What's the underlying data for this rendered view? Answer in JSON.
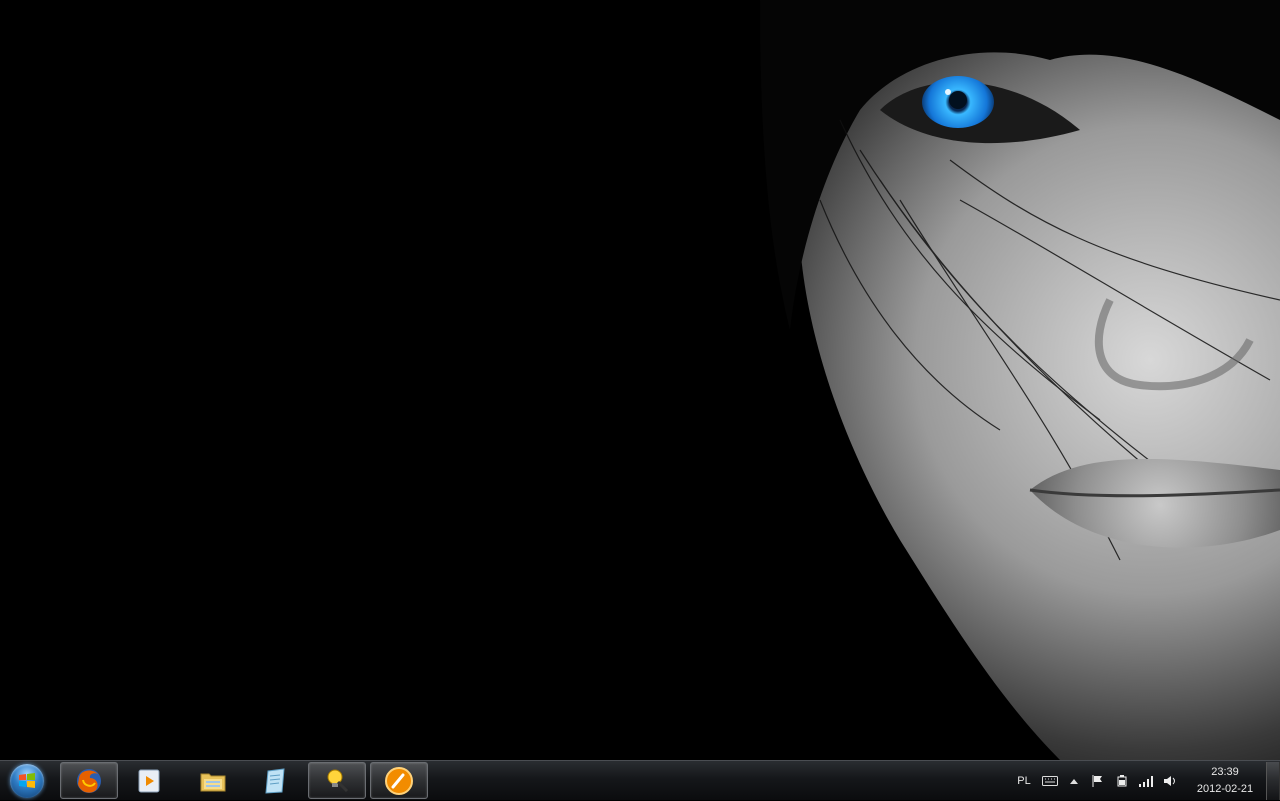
{
  "desktop": {
    "wallpaper": "dark-portrait-blue-eye"
  },
  "taskbar": {
    "start": {
      "icon": "windows-start-orb-icon"
    },
    "pinned": [
      {
        "name": "firefox",
        "icon": "firefox-icon",
        "running": true
      },
      {
        "name": "media-player",
        "icon": "media-player-icon",
        "running": false
      },
      {
        "name": "explorer",
        "icon": "folder-icon",
        "running": false
      },
      {
        "name": "notepad",
        "icon": "notepad-icon",
        "running": false
      },
      {
        "name": "tool",
        "icon": "bulb-icon",
        "running": true
      },
      {
        "name": "orange-app",
        "icon": "orange-circle-icon",
        "running": true
      }
    ]
  },
  "tray": {
    "language": "PL",
    "icons": [
      "keyboard-icon",
      "show-hidden-icons-chevron",
      "action-center-flag-icon",
      "power-icon",
      "network-signal-icon",
      "volume-icon"
    ],
    "time": "23:39",
    "date": "2012-02-21"
  },
  "colors": {
    "eye_blue": "#1ea0ff",
    "taskbar_bg": "#15171a"
  }
}
